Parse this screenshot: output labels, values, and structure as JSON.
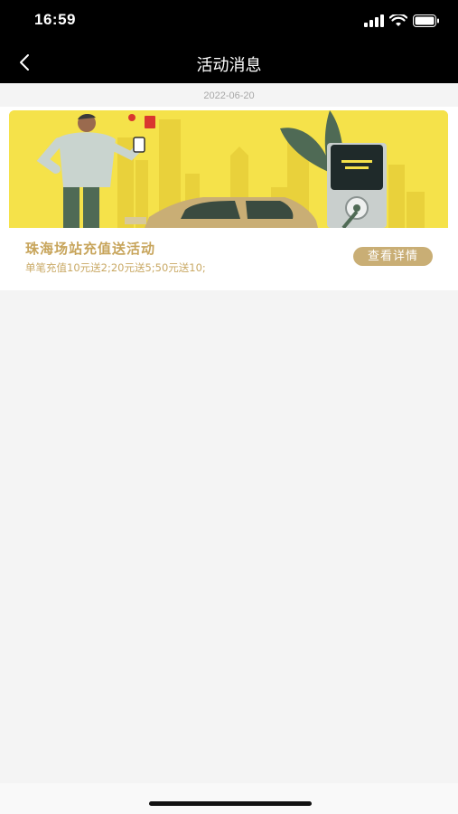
{
  "status_bar": {
    "time": "16:59"
  },
  "nav": {
    "title": "活动消息"
  },
  "messages": [
    {
      "date": "2022-06-20",
      "title": "珠海场站充值送活动",
      "description": "单笔充值10元送2;20元送5;50元送10;",
      "button_label": "查看详情"
    }
  ],
  "colors": {
    "nav_background": "#000000",
    "accent_gold": "#c9ae75",
    "banner_yellow": "#f5e24a",
    "page_background": "#f4f4f4"
  }
}
